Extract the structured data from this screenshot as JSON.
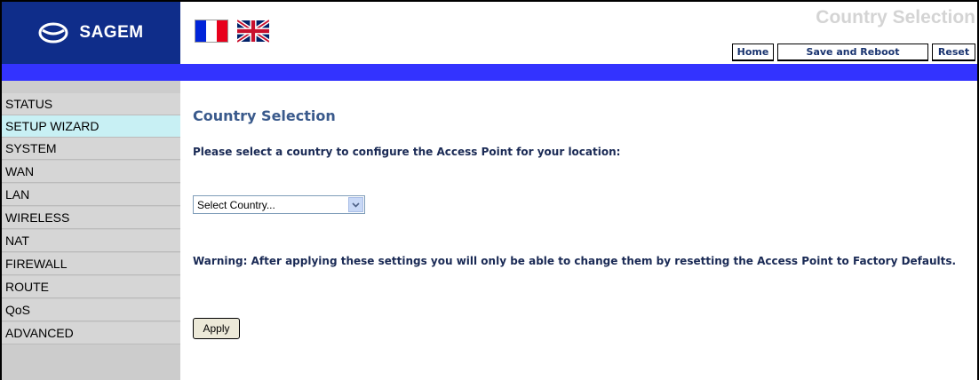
{
  "header": {
    "brand": "SAGEM",
    "page_title": "Country Selection",
    "nav_buttons": [
      "Home",
      "Save and Reboot",
      "Reset"
    ],
    "flags": [
      "france-flag-icon",
      "uk-flag-icon"
    ]
  },
  "sidebar": {
    "items": [
      {
        "label": "STATUS"
      },
      {
        "label": "SETUP WIZARD"
      },
      {
        "label": "SYSTEM"
      },
      {
        "label": "WAN"
      },
      {
        "label": "LAN"
      },
      {
        "label": "WIRELESS"
      },
      {
        "label": "NAT"
      },
      {
        "label": "FIREWALL"
      },
      {
        "label": "ROUTE"
      },
      {
        "label": "QoS"
      },
      {
        "label": "ADVANCED"
      }
    ]
  },
  "main": {
    "title": "Country Selection",
    "prompt": "Please select a country to configure the Access Point for your location:",
    "country_select": "Select Country...",
    "warning": "Warning: After applying these settings you will only be able to change them by resetting the Access Point to Factory Defaults.",
    "apply_label": "Apply"
  },
  "colors": {
    "brand_blue": "#0f2d8a",
    "bar_blue": "#3333ff",
    "sidebar_gray": "#cccccc",
    "active_cyan": "#c8f0f4",
    "title_blue": "#3a5a8c"
  }
}
